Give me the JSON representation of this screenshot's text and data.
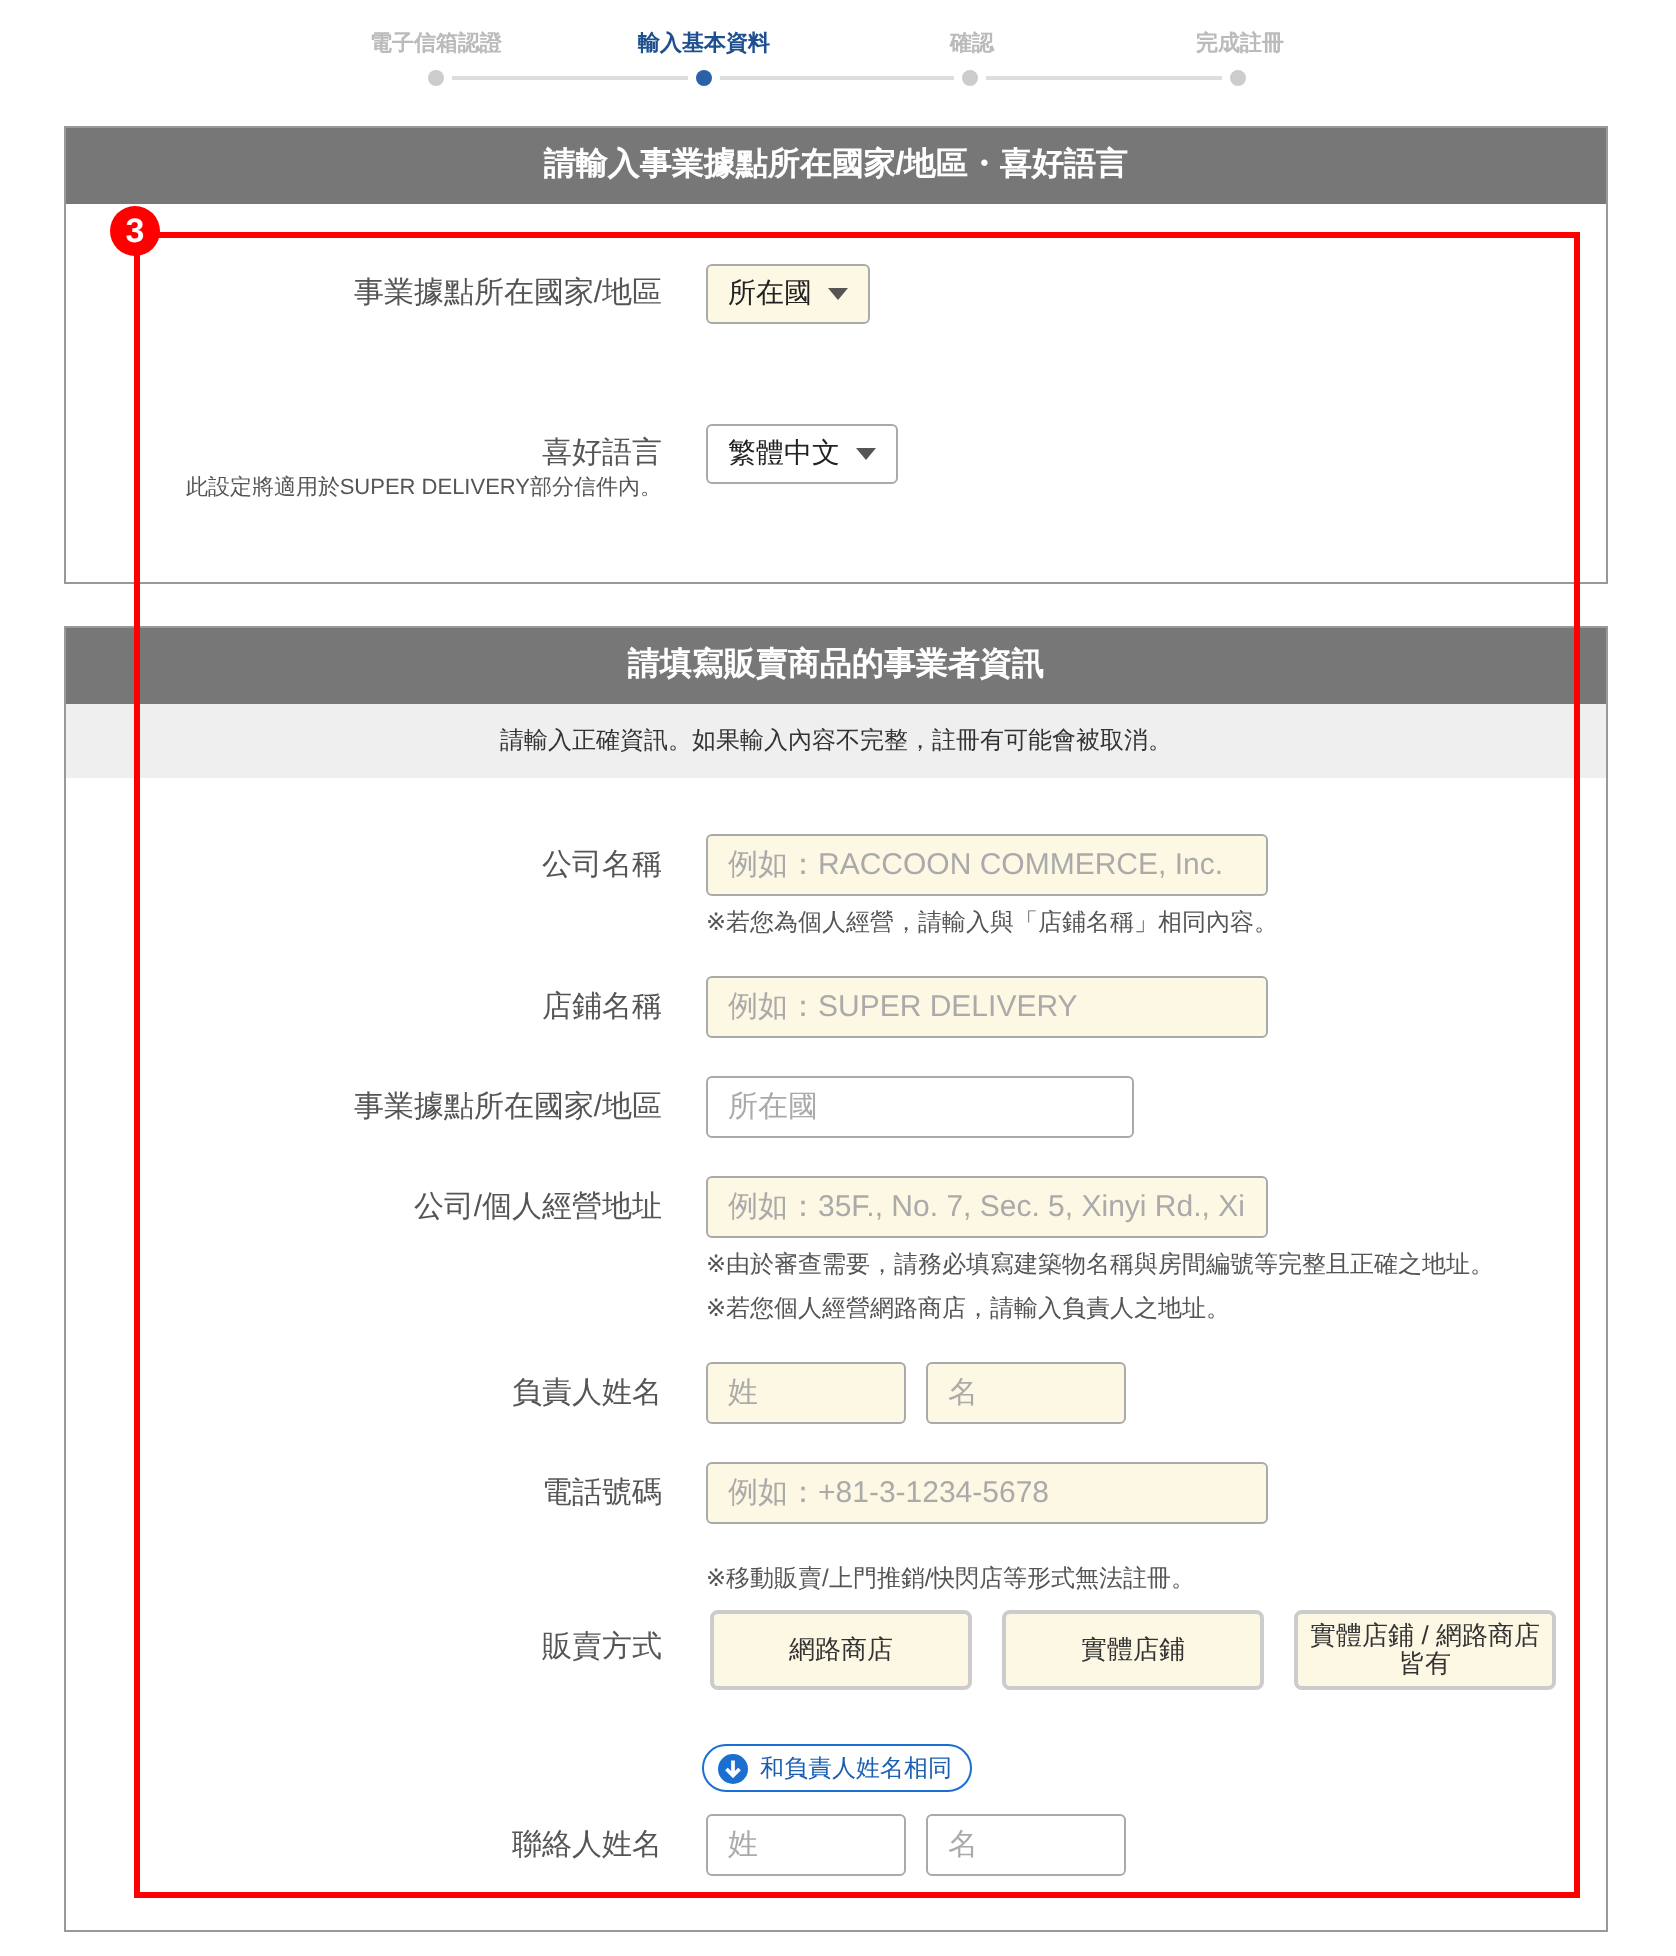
{
  "steps": [
    {
      "label": "電子信箱認證",
      "selected": false
    },
    {
      "label": "輸入基本資料",
      "selected": true
    },
    {
      "label": "確認",
      "selected": false
    },
    {
      "label": "完成註冊",
      "selected": false
    }
  ],
  "region_section": {
    "title": "請輸入事業據點所在國家/地區・喜好語言",
    "rows": [
      {
        "label": "事業據點所在國家/地區",
        "value": "所在國",
        "highlighted": true
      },
      {
        "label": "喜好語言",
        "sublabel": "此設定將適用於SUPER DELIVERY部分信件內。",
        "value": "繁體中文",
        "highlighted": false
      }
    ]
  },
  "business_section": {
    "title": "請填寫販賣商品的事業者資訊",
    "notice": "請輸入正確資訊。如果輸入內容不完整，註冊有可能會被取消。",
    "rows": [
      {
        "kind": "input",
        "label": "公司名稱",
        "fields": [
          {
            "placeholder": "例如：RACCOON COMMERCE, Inc.",
            "kind": "text",
            "highlighted": true
          }
        ],
        "notes": [
          "※若您為個人經營，請輸入與「店鋪名稱」相同內容。"
        ]
      },
      {
        "kind": "input",
        "label": "店鋪名稱",
        "fields": [
          {
            "placeholder": "例如：SUPER DELIVERY",
            "kind": "text",
            "highlighted": true
          }
        ]
      },
      {
        "kind": "input",
        "label": "事業據點所在國家/地區",
        "fields": [
          {
            "placeholder": "所在國",
            "kind": "country",
            "highlighted": false
          }
        ]
      },
      {
        "kind": "input",
        "label": "公司/個人經營地址",
        "fields": [
          {
            "placeholder": "例如：35F., No. 7, Sec. 5, Xinyi Rd., Xi",
            "kind": "text",
            "highlighted": true
          }
        ],
        "notes": [
          "※由於審查需要，請務必填寫建築物名稱與房間編號等完整且正確之地址。",
          "※若您個人經營網路商店，請輸入負責人之地址。"
        ]
      },
      {
        "kind": "input",
        "label": "負責人姓名",
        "fields": [
          {
            "placeholder": "姓",
            "kind": "name",
            "highlighted": true
          },
          {
            "placeholder": "名",
            "kind": "name",
            "highlighted": true
          }
        ]
      },
      {
        "kind": "input",
        "label": "電話號碼",
        "fields": [
          {
            "placeholder": "例如：+81-3-1234-5678",
            "kind": "text",
            "highlighted": true
          }
        ]
      },
      {
        "kind": "choice",
        "label": "販賣方式",
        "note": "※移動販賣/上門推銷/快閃店等形式無法註冊。",
        "options": [
          "網路商店",
          "實體店鋪",
          "實體店鋪 / 網路商店皆有"
        ]
      },
      {
        "kind": "link",
        "text": "和負責人姓名相同"
      },
      {
        "kind": "input",
        "label": "聯絡人姓名",
        "fields": [
          {
            "placeholder": "姓",
            "kind": "name",
            "highlighted": false
          },
          {
            "placeholder": "名",
            "kind": "name",
            "highlighted": false
          }
        ]
      }
    ]
  },
  "annotation": {
    "number": "3"
  }
}
